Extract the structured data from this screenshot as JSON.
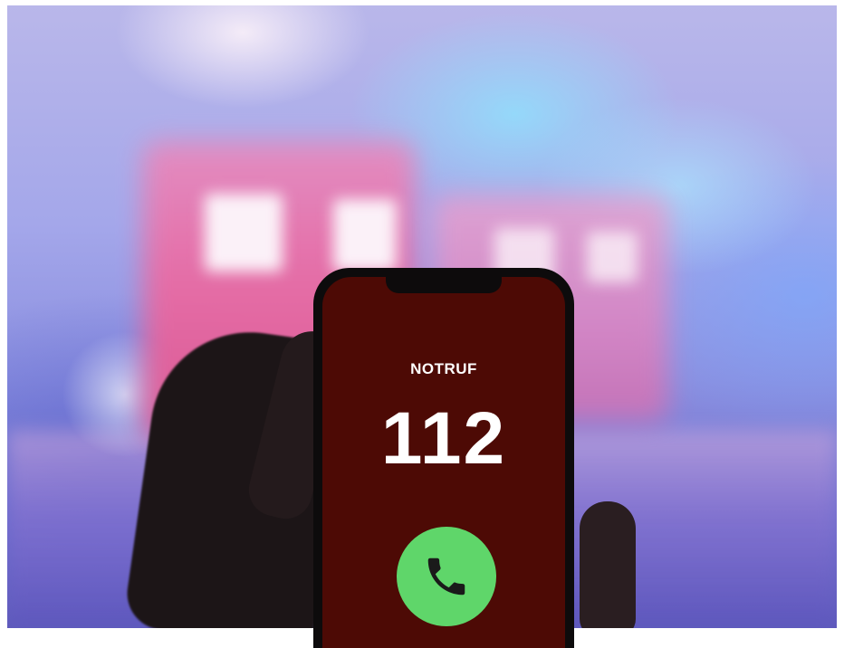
{
  "phone": {
    "label": "NOTRUF",
    "number": "112",
    "call_icon": "phone-icon"
  },
  "colors": {
    "screen": "#4d0a05",
    "call_button": "#5fd66a",
    "text": "#ffffff"
  }
}
